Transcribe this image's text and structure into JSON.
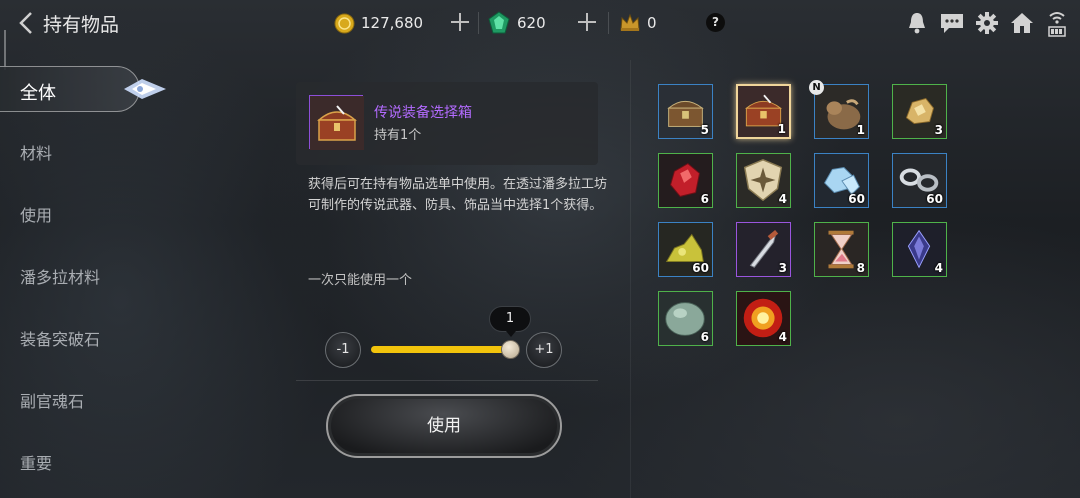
{
  "header": {
    "title": "持有物品",
    "gold": "127,680",
    "gems": "620",
    "crowns": "0",
    "help": "?"
  },
  "sidebar": {
    "items": [
      {
        "label": "全体",
        "active": true
      },
      {
        "label": "材料"
      },
      {
        "label": "使用"
      },
      {
        "label": "潘多拉材料"
      },
      {
        "label": "装备突破石"
      },
      {
        "label": "副官魂石"
      },
      {
        "label": "重要"
      }
    ]
  },
  "detail": {
    "name": "传说装备选择箱",
    "owned": "持有1个",
    "description": "获得后可在持有物品选单中使用。在透过潘多拉工坊可制作的传说武器、防具、饰品当中选择1个获得。",
    "note": "一次只能使用一个",
    "minus": "-1",
    "plus": "+1",
    "quantity": "1",
    "quantity_fraction": 1.0,
    "use_label": "使用"
  },
  "inventory": {
    "badge": "N",
    "items": [
      {
        "icon": "chest-icon",
        "count": "5",
        "rarity": "blue"
      },
      {
        "icon": "legendary-chest-icon",
        "count": "1",
        "rarity": "purple",
        "selected": true
      },
      {
        "icon": "pouch-icon",
        "count": "1",
        "rarity": "blue",
        "new": true
      },
      {
        "icon": "gold-ore-icon",
        "count": "3",
        "rarity": "green"
      },
      {
        "icon": "red-crystal-icon",
        "count": "6",
        "rarity": "green"
      },
      {
        "icon": "shield-emblem-icon",
        "count": "4",
        "rarity": "green"
      },
      {
        "icon": "ice-crystal-icon",
        "count": "60",
        "rarity": "blue"
      },
      {
        "icon": "chain-icon",
        "count": "60",
        "rarity": "blue"
      },
      {
        "icon": "sulfur-ore-icon",
        "count": "60",
        "rarity": "blue"
      },
      {
        "icon": "dagger-icon",
        "count": "3",
        "rarity": "purple"
      },
      {
        "icon": "hourglass-icon",
        "count": "8",
        "rarity": "green"
      },
      {
        "icon": "dark-gem-icon",
        "count": "4",
        "rarity": "green"
      },
      {
        "icon": "stone-icon",
        "count": "6",
        "rarity": "green"
      },
      {
        "icon": "fire-orb-icon",
        "count": "4",
        "rarity": "green"
      }
    ]
  }
}
